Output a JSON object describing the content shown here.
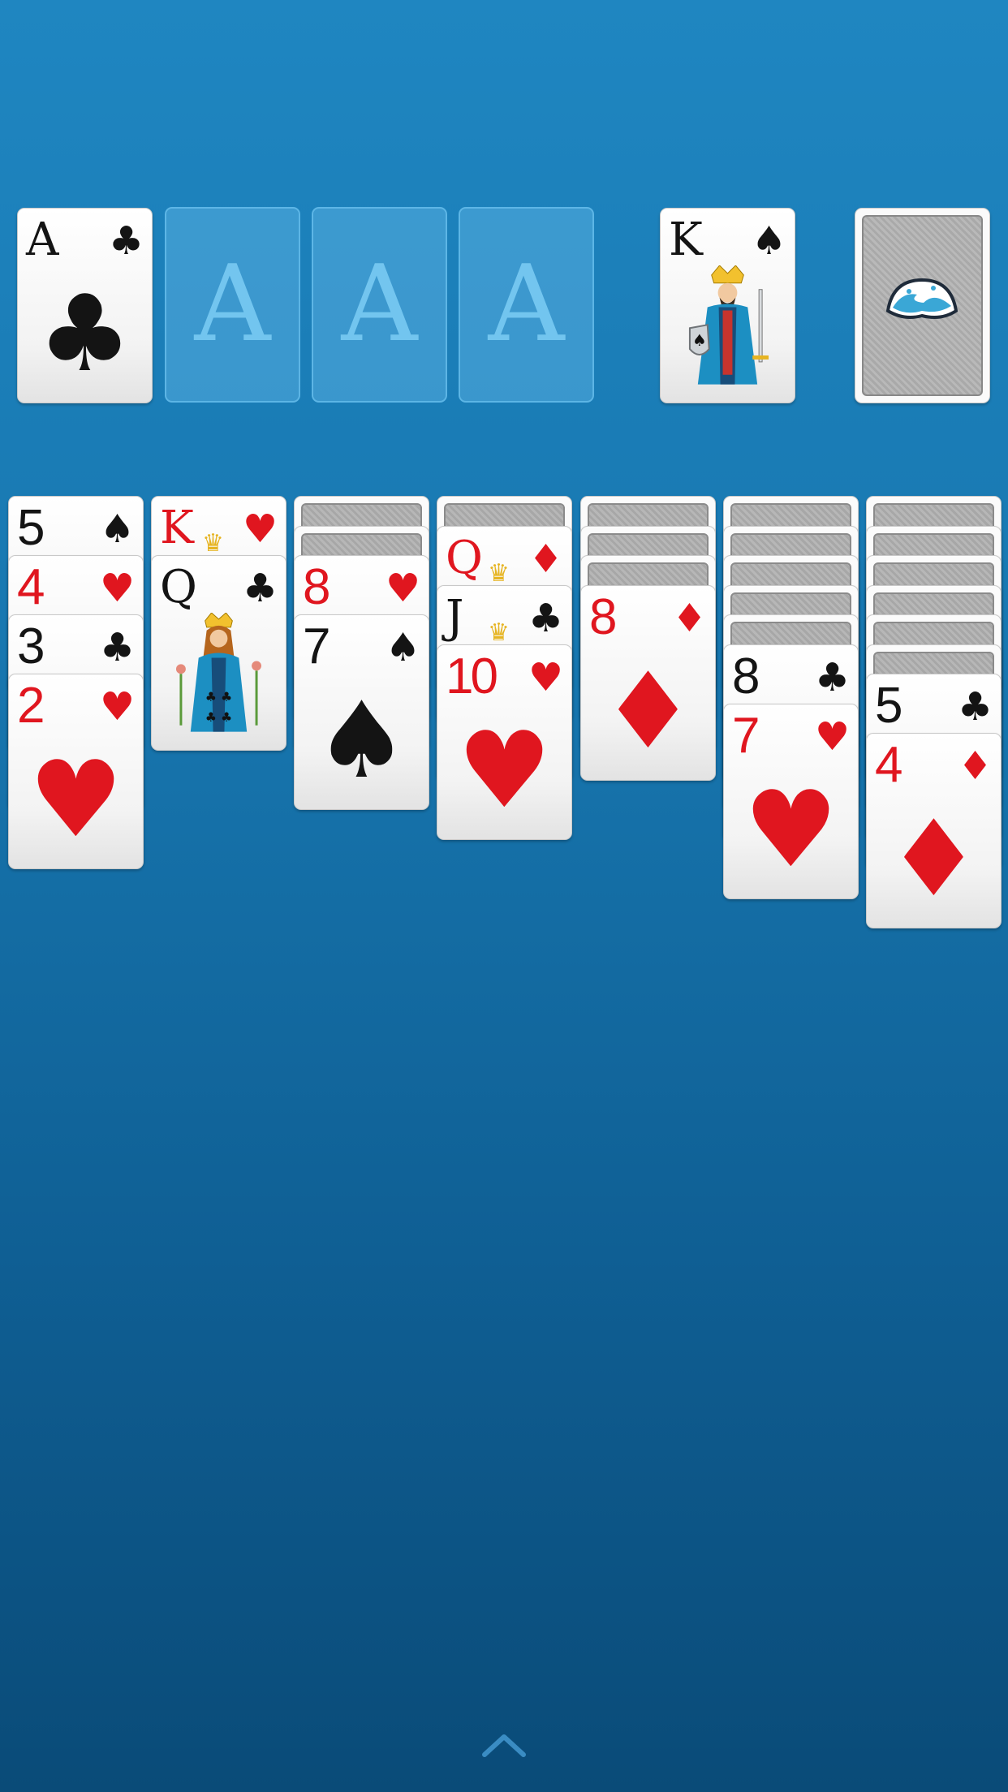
{
  "foundations": [
    {
      "rank": "A",
      "suit": "♣",
      "color": "black",
      "placeholder": false
    },
    {
      "rank": "A",
      "placeholder": true
    },
    {
      "rank": "A",
      "placeholder": true
    },
    {
      "rank": "A",
      "placeholder": true
    }
  ],
  "waste": {
    "rank": "K",
    "suit": "♠",
    "color": "black",
    "face": "king-of-spades-figure"
  },
  "stock": {
    "back_icon": "ocean-wave-icon"
  },
  "tableau": [
    {
      "facedown": 0,
      "cards": [
        {
          "rank": "5",
          "suit": "♠",
          "color": "black"
        },
        {
          "rank": "4",
          "suit": "♥",
          "color": "red"
        },
        {
          "rank": "3",
          "suit": "♣",
          "color": "black"
        },
        {
          "rank": "2",
          "suit": "♥",
          "color": "red"
        }
      ]
    },
    {
      "facedown": 0,
      "cards": [
        {
          "rank": "K",
          "suit": "♥",
          "color": "red"
        },
        {
          "rank": "Q",
          "suit": "♣",
          "color": "black",
          "face": "queen-of-clubs-figure"
        }
      ]
    },
    {
      "facedown": 2,
      "cards": [
        {
          "rank": "8",
          "suit": "♥",
          "color": "red"
        },
        {
          "rank": "7",
          "suit": "♠",
          "color": "black"
        }
      ]
    },
    {
      "facedown": 1,
      "cards": [
        {
          "rank": "Q",
          "suit": "♦",
          "color": "red"
        },
        {
          "rank": "J",
          "suit": "♣",
          "color": "black"
        },
        {
          "rank": "10",
          "suit": "♥",
          "color": "red"
        }
      ]
    },
    {
      "facedown": 3,
      "cards": [
        {
          "rank": "8",
          "suit": "♦",
          "color": "red"
        }
      ]
    },
    {
      "facedown": 5,
      "cards": [
        {
          "rank": "8",
          "suit": "♣",
          "color": "black"
        },
        {
          "rank": "7",
          "suit": "♥",
          "color": "red"
        }
      ]
    },
    {
      "facedown": 6,
      "cards": [
        {
          "rank": "5",
          "suit": "♣",
          "color": "black"
        },
        {
          "rank": "4",
          "suit": "♦",
          "color": "red"
        }
      ]
    }
  ],
  "bottom": {
    "menu_icon": "chevron-up-icon"
  }
}
